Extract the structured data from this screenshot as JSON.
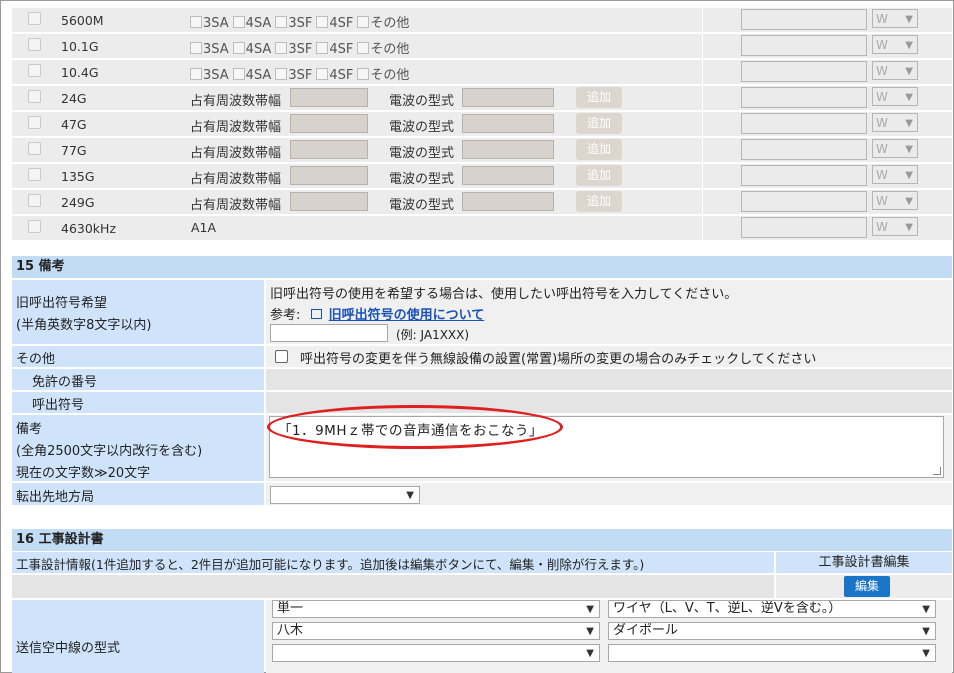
{
  "freq_rows": [
    {
      "freq": "5600M",
      "type": "check",
      "opts": [
        "3SA",
        "4SA",
        "3SF",
        "4SF",
        "その他"
      ],
      "unit": "W"
    },
    {
      "freq": "10.1G",
      "type": "check",
      "opts": [
        "3SA",
        "4SA",
        "3SF",
        "4SF",
        "その他"
      ],
      "unit": "W"
    },
    {
      "freq": "10.4G",
      "type": "check",
      "opts": [
        "3SA",
        "4SA",
        "3SF",
        "4SF",
        "その他"
      ],
      "unit": "W"
    },
    {
      "freq": "24G",
      "type": "add",
      "label1": "占有周波数帯幅",
      "label2": "電波の型式",
      "add": "追加",
      "unit": "W"
    },
    {
      "freq": "47G",
      "type": "add",
      "label1": "占有周波数帯幅",
      "label2": "電波の型式",
      "add": "追加",
      "unit": "W"
    },
    {
      "freq": "77G",
      "type": "add",
      "label1": "占有周波数帯幅",
      "label2": "電波の型式",
      "add": "追加",
      "unit": "W"
    },
    {
      "freq": "135G",
      "type": "add",
      "label1": "占有周波数帯幅",
      "label2": "電波の型式",
      "add": "追加",
      "unit": "W"
    },
    {
      "freq": "249G",
      "type": "add",
      "label1": "占有周波数帯幅",
      "label2": "電波の型式",
      "add": "追加",
      "unit": "W"
    },
    {
      "freq": "4630kHz",
      "type": "text",
      "text": "A1A",
      "unit": "W"
    }
  ],
  "s15": {
    "title": "15 備考",
    "old_call": {
      "label1": "旧呼出符号希望",
      "label2": "(半角英数字8文字以内)",
      "desc": "旧呼出符号の使用を希望する場合は、使用したい呼出符号を入力してください。",
      "ref_prefix": "参考:",
      "ref_link": "旧呼出符号の使用について",
      "example": "(例: JA1XXX)",
      "value": ""
    },
    "other": {
      "label": "その他",
      "check_text": "呼出符号の変更を伴う無線設備の設置(常置)場所の変更の場合のみチェックしてください"
    },
    "license_no": "免許の番号",
    "call_sign": "呼出符号",
    "remarks": {
      "label1": "備考",
      "label2": "(全角2500文字以内改行を含む)",
      "label3": "現在の文字数≫20文字",
      "value": "「1．9MHｚ帯での音声通信をおこなう」"
    },
    "bureau": {
      "label": "転出先地方局",
      "value": ""
    }
  },
  "s16": {
    "title": "16 工事設計書",
    "info": "工事設計情報(1件追加すると、2件目が追加可能になります。追加後は編集ボタンにて、編集・削除が行えます。)",
    "edit_header": "工事設計書編集",
    "edit_btn": "編集",
    "antenna_label": "送信空中線の型式",
    "antenna_rows": [
      [
        "単一",
        "ワイヤ（L、V、T、逆L、逆Vを含む。）"
      ],
      [
        "八木",
        "ダイポール"
      ],
      [
        "",
        ""
      ]
    ]
  },
  "colors": {
    "highlight": "#e02020",
    "section": "#c3dcf6",
    "label_cell": "#cfe4fa",
    "button": "#1a75c8"
  }
}
